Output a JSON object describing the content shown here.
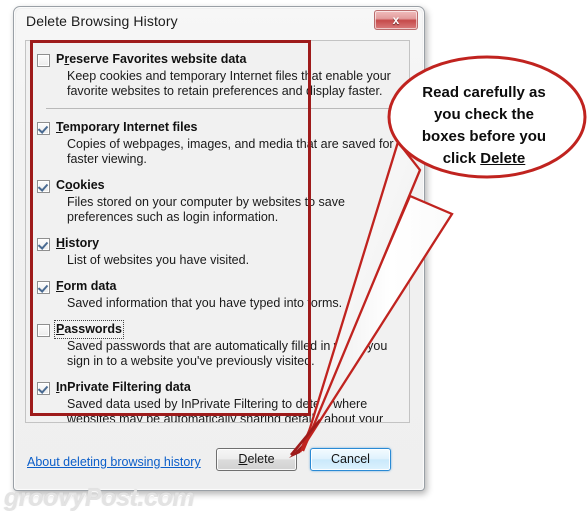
{
  "window": {
    "title": "Delete Browsing History",
    "close_label": "x"
  },
  "options": [
    {
      "id": "preserve-favorites",
      "label_pre": "P",
      "label_acc": "r",
      "label_post": "eserve Favorites website data",
      "label_full": "Preserve Favorites website data",
      "checked": false,
      "focused": false,
      "description": "Keep cookies and temporary Internet files that enable your favorite websites to retain preferences and display faster."
    },
    {
      "id": "temporary-internet-files",
      "label_pre": "",
      "label_acc": "T",
      "label_post": "emporary Internet files",
      "label_full": "Temporary Internet files",
      "checked": true,
      "focused": false,
      "description": "Copies of webpages, images, and media that are saved for faster viewing."
    },
    {
      "id": "cookies",
      "label_pre": "C",
      "label_acc": "o",
      "label_post": "okies",
      "label_full": "Cookies",
      "checked": true,
      "focused": false,
      "description": "Files stored on your computer by websites to save preferences such as login information."
    },
    {
      "id": "history",
      "label_pre": "",
      "label_acc": "H",
      "label_post": "istory",
      "label_full": "History",
      "checked": true,
      "focused": false,
      "description": "List of websites you have visited."
    },
    {
      "id": "form-data",
      "label_pre": "",
      "label_acc": "F",
      "label_post": "orm data",
      "label_full": "Form data",
      "checked": true,
      "focused": false,
      "description": "Saved information that you have typed into forms."
    },
    {
      "id": "passwords",
      "label_pre": "",
      "label_acc": "P",
      "label_post": "asswords",
      "label_full": "Passwords",
      "checked": false,
      "focused": true,
      "description": "Saved passwords that are automatically filled in when you sign in to a website you've previously visited."
    },
    {
      "id": "inprivate-filtering-data",
      "label_pre": "",
      "label_acc": "I",
      "label_post": "nPrivate Filtering data",
      "label_full": "InPrivate Filtering data",
      "checked": true,
      "focused": false,
      "description": "Saved data used by InPrivate Filtering to detect where websites may be automatically sharing details about your visit."
    }
  ],
  "footer": {
    "about_link": "About deleting browsing history",
    "delete_pre": "",
    "delete_acc": "D",
    "delete_post": "elete",
    "delete_label": "Delete",
    "cancel_label": "Cancel"
  },
  "annotation": {
    "callout_line1": "Read carefully as",
    "callout_line2": "you check the",
    "callout_line3": "boxes before you",
    "callout_line4_pre": "click ",
    "callout_line4_underlined": "Delete",
    "rect_color": "#9E1B1B",
    "bubble_outline_color": "#C0231F"
  },
  "watermark": "groovyPost.com"
}
